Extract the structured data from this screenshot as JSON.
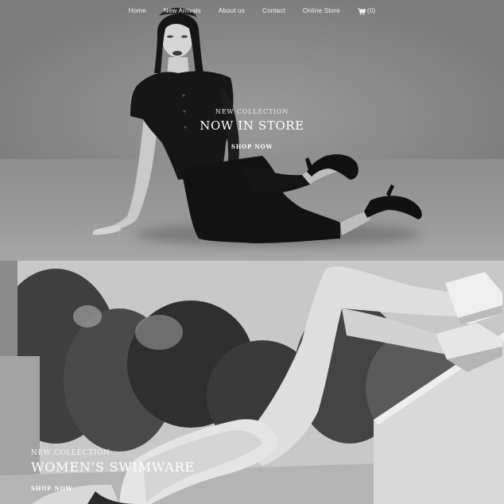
{
  "nav": {
    "items": [
      {
        "label": "Home"
      },
      {
        "label": "New Arrivals"
      },
      {
        "label": "About us"
      },
      {
        "label": "Contact"
      },
      {
        "label": "Online Store"
      }
    ],
    "cart_count": "(0)",
    "cart_icon": "cart-icon"
  },
  "hero_top": {
    "eyebrow": "NEW COLLECTION",
    "title": "NOW IN STORE",
    "cta": "SHOP NOW"
  },
  "hero_bottom": {
    "eyebrow": "NEW COLLECTION",
    "title": "WOMEN'S SWIMWARE",
    "cta": "SHOP NOW"
  },
  "colors": {
    "text": "#ffffff",
    "hero_bg": "#8c8c8c",
    "dark_garment": "#161616"
  }
}
